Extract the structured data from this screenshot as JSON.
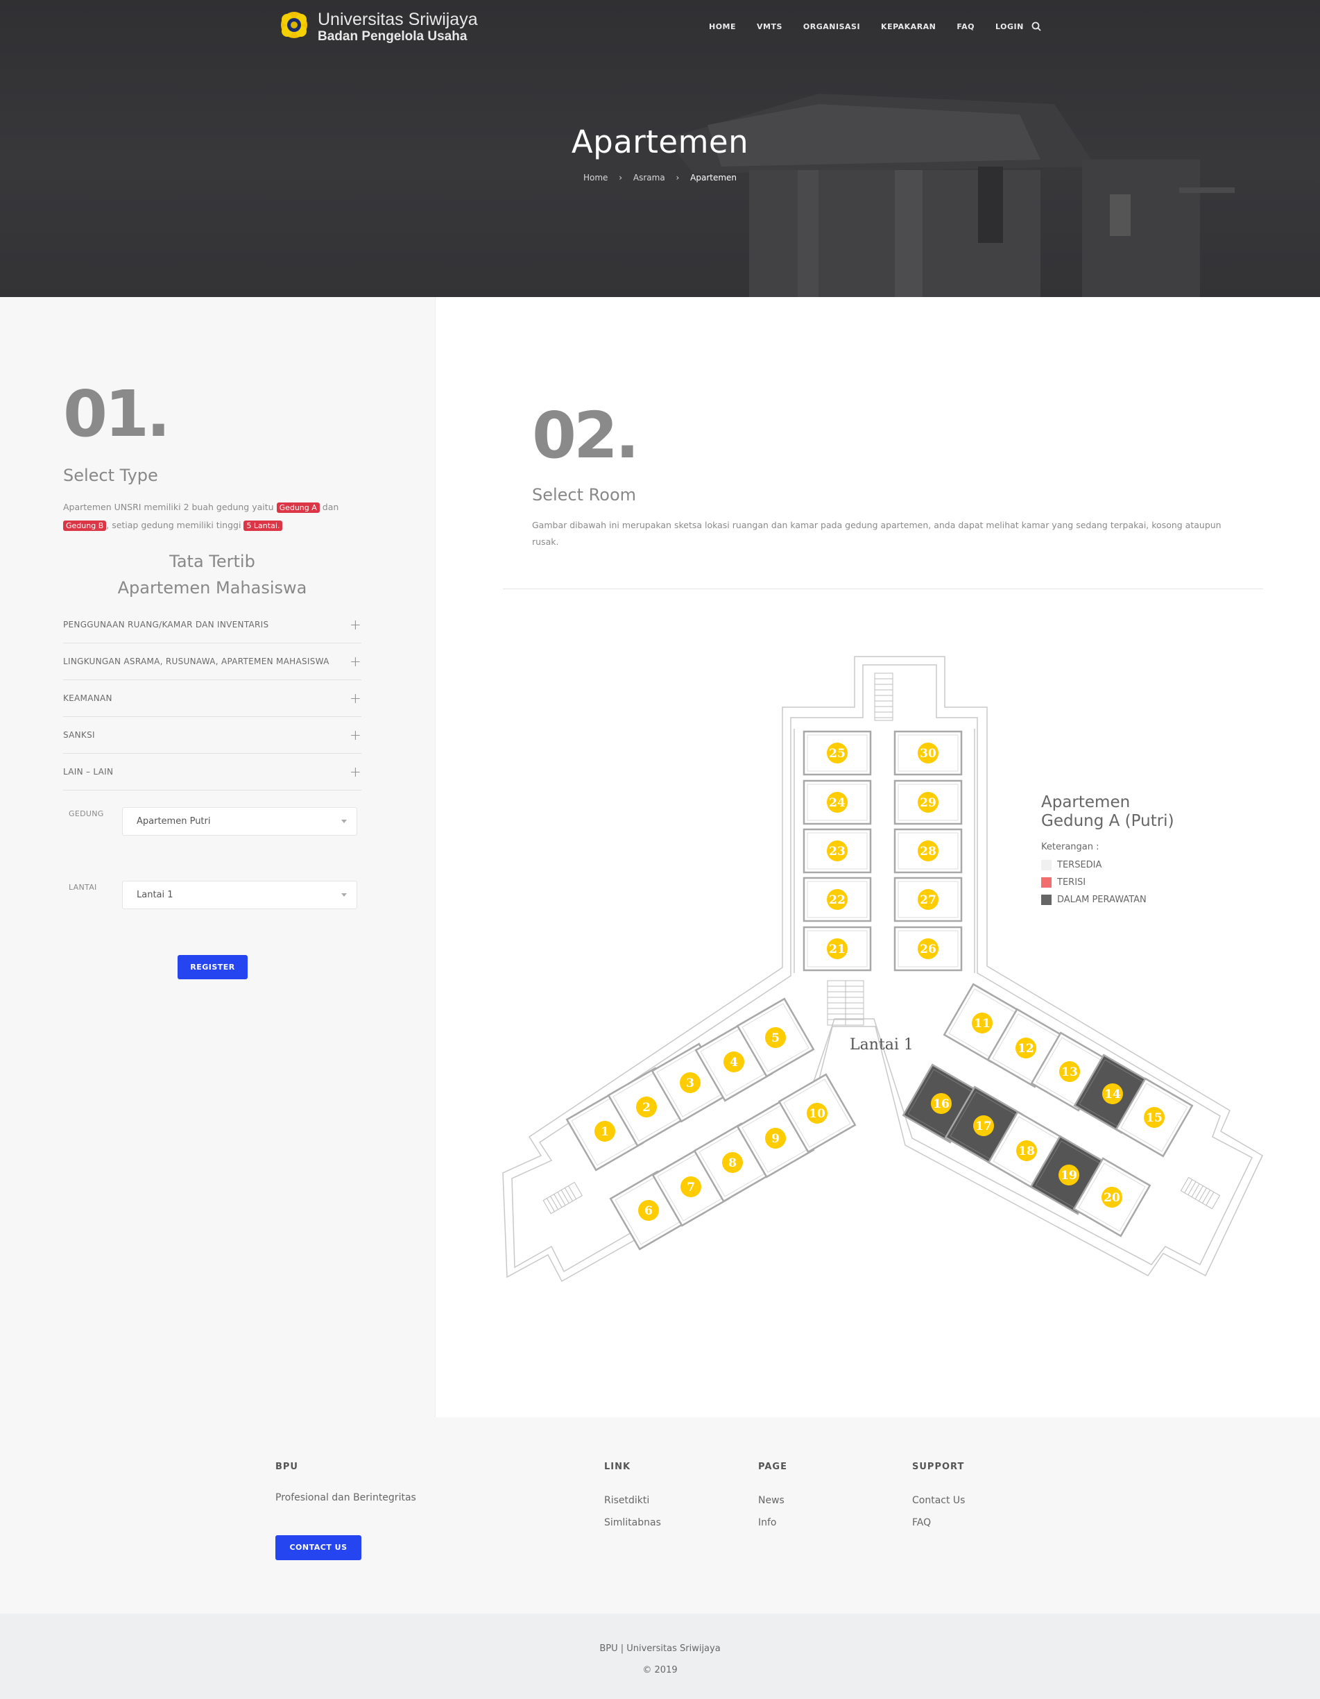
{
  "header": {
    "logo_line1": "Universitas Sriwijaya",
    "logo_line2": "Badan Pengelola Usaha",
    "nav": [
      "HOME",
      "VMTS",
      "ORGANISASI",
      "KEPAKARAN",
      "FAQ",
      "LOGIN"
    ],
    "page_title": "Apartemen",
    "breadcrumb": [
      "Home",
      "Asrama",
      "Apartemen"
    ]
  },
  "step1": {
    "number": "01.",
    "title": "Select Type",
    "intro_pre": "Apartemen UNSRI memiliki 2 buah gedung yaitu",
    "tag_a": "Gedung A",
    "intro_mid": "dan",
    "tag_b": "Gedung B",
    "intro_post": ", setiap gedung memiliki tinggi",
    "tag_floors": "5 Lantai.",
    "rules_title_1": "Tata Tertib",
    "rules_title_2": "Apartemen Mahasiswa",
    "accordion": [
      "PENGGUNAAN RUANG/KAMAR DAN INVENTARIS",
      "LINGKUNGAN ASRAMA, RUSUNAWA, APARTEMEN MAHASISWA",
      "KEAMANAN",
      "SANKSI",
      "LAIN – LAIN"
    ],
    "gedung_label": "GEDUNG",
    "gedung_value": "Apartemen Putri",
    "lantai_label": "LANTAI",
    "lantai_value": "Lantai 1",
    "register": "REGISTER"
  },
  "step2": {
    "number": "02.",
    "title": "Select Room",
    "description": "Gambar dibawah ini merupakan sketsa lokasi ruangan dan kamar pada gedung apartemen, anda dapat melihat kamar yang sedang terpakai, kosong ataupun rusak.",
    "plan_label": "Lantai 1",
    "building_title_1": "Apartemen",
    "building_title_2": "Gedung A (Putri)",
    "legend_label": "Keterangan :",
    "legend": [
      {
        "label": "TERSEDIA",
        "color": "#f0f0f0"
      },
      {
        "label": "TERISI",
        "color": "#f26d6d"
      },
      {
        "label": "DALAM PERAWATAN",
        "color": "#666666"
      }
    ],
    "maintenance_rooms": [
      14,
      16,
      17,
      19
    ]
  },
  "footer": {
    "bpu_heading": "BPU",
    "bpu_text": "Profesional dan Berintegritas",
    "contact": "CONTACT US",
    "link_heading": "LINK",
    "links": [
      "Risetdikti",
      "Simlitabnas"
    ],
    "page_heading": "PAGE",
    "pages": [
      "News",
      "Info"
    ],
    "support_heading": "SUPPORT",
    "support": [
      "Contact Us",
      "FAQ"
    ],
    "credit": "BPU | Universitas Sriwijaya",
    "year": "© 2019"
  }
}
